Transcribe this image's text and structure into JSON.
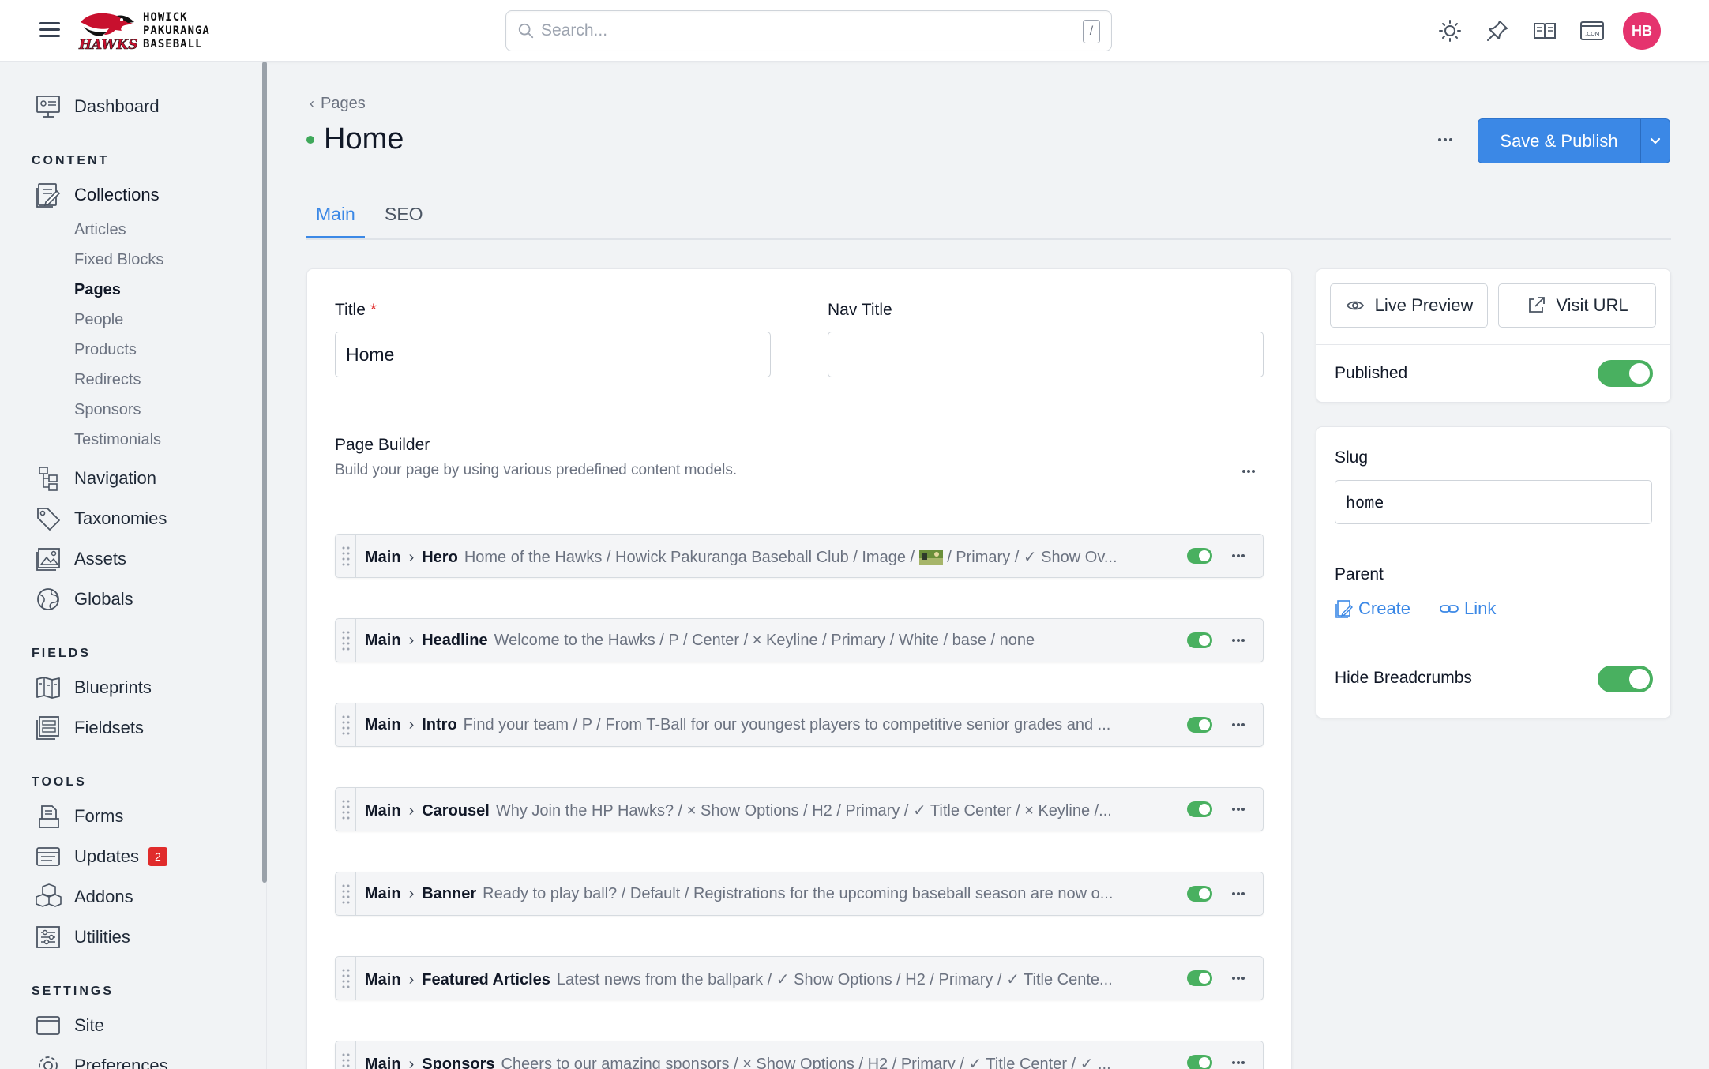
{
  "app": {
    "logo_text": [
      "HOWICK",
      "PAKURANGA",
      "BASEBALL"
    ],
    "logo_word": "HAWKS",
    "search_placeholder": "Search...",
    "search_shortcut": "/",
    "avatar_initials": "HB",
    "top_icons": [
      "sun-icon",
      "pin-icon",
      "docs-book-icon",
      "site-com-icon"
    ]
  },
  "sidebar": {
    "dashboard": "Dashboard",
    "content_title": "CONTENT",
    "collections": "Collections",
    "collection_items": [
      "Articles",
      "Fixed Blocks",
      "Pages",
      "People",
      "Products",
      "Redirects",
      "Sponsors",
      "Testimonials"
    ],
    "current_collection": "Pages",
    "navigation": "Navigation",
    "taxonomies": "Taxonomies",
    "assets": "Assets",
    "globals": "Globals",
    "fields_title": "FIELDS",
    "blueprints": "Blueprints",
    "fieldsets": "Fieldsets",
    "tools_title": "TOOLS",
    "forms": "Forms",
    "updates": "Updates",
    "updates_badge": "2",
    "addons": "Addons",
    "utilities": "Utilities",
    "settings_title": "SETTINGS",
    "site": "Site",
    "preferences": "Preferences"
  },
  "header": {
    "breadcrumb": "Pages",
    "title": "Home",
    "status_color": "#3fa85a",
    "publish_label": "Save & Publish",
    "tabs": [
      "Main",
      "SEO"
    ],
    "active_tab": "Main"
  },
  "form": {
    "title_label": "Title",
    "title_required": "*",
    "title_value": "Home",
    "nav_title_label": "Nav Title",
    "nav_title_value": "",
    "page_builder_title": "Page Builder",
    "page_builder_desc": "Build your page by using various predefined content models.",
    "sets": [
      {
        "group": "Main",
        "type": "Hero",
        "preview": "Home of the Hawks / Howick Pakuranga Baseball Club / Image / ",
        "preview_tail": " / Primary / ✓ Show Ov...",
        "has_thumb": true,
        "enabled": true
      },
      {
        "group": "Main",
        "type": "Headline",
        "preview": "Welcome to the Hawks / P / Center / × Keyline / Primary / White / base / none",
        "preview_tail": "",
        "has_thumb": false,
        "enabled": true
      },
      {
        "group": "Main",
        "type": "Intro",
        "preview": "Find your team / P / From T-Ball for our youngest players to competitive senior grades and ...",
        "preview_tail": "",
        "has_thumb": false,
        "enabled": true
      },
      {
        "group": "Main",
        "type": "Carousel",
        "preview": "Why Join the HP Hawks? / × Show Options / H2 / Primary / ✓ Title Center / × Keyline /...",
        "preview_tail": "",
        "has_thumb": false,
        "enabled": true
      },
      {
        "group": "Main",
        "type": "Banner",
        "preview": "Ready to play ball? / Default / Registrations for the upcoming baseball season are now o...",
        "preview_tail": "",
        "has_thumb": false,
        "enabled": true
      },
      {
        "group": "Main",
        "type": "Featured Articles",
        "preview": "Latest news from the ballpark / ✓ Show Options / H2 / Primary / ✓ Title Cente...",
        "preview_tail": "",
        "has_thumb": false,
        "enabled": true
      },
      {
        "group": "Main",
        "type": "Sponsors",
        "preview": "Cheers to our amazing sponsors / × Show Options / H2 / Primary / ✓ Title Center / ✓ ...",
        "preview_tail": "",
        "has_thumb": false,
        "enabled": true
      }
    ]
  },
  "side": {
    "live_preview": "Live Preview",
    "visit_url": "Visit URL",
    "published_label": "Published",
    "published": true,
    "slug_label": "Slug",
    "slug_value": "home",
    "parent_label": "Parent",
    "create_label": "Create",
    "link_label": "Link",
    "hide_breadcrumbs_label": "Hide Breadcrumbs",
    "hide_breadcrumbs": true
  },
  "colors": {
    "accent": "#3b88e6",
    "toggle_on": "#49b060",
    "badge": "#e02b2b",
    "avatar": "#e5336e"
  }
}
